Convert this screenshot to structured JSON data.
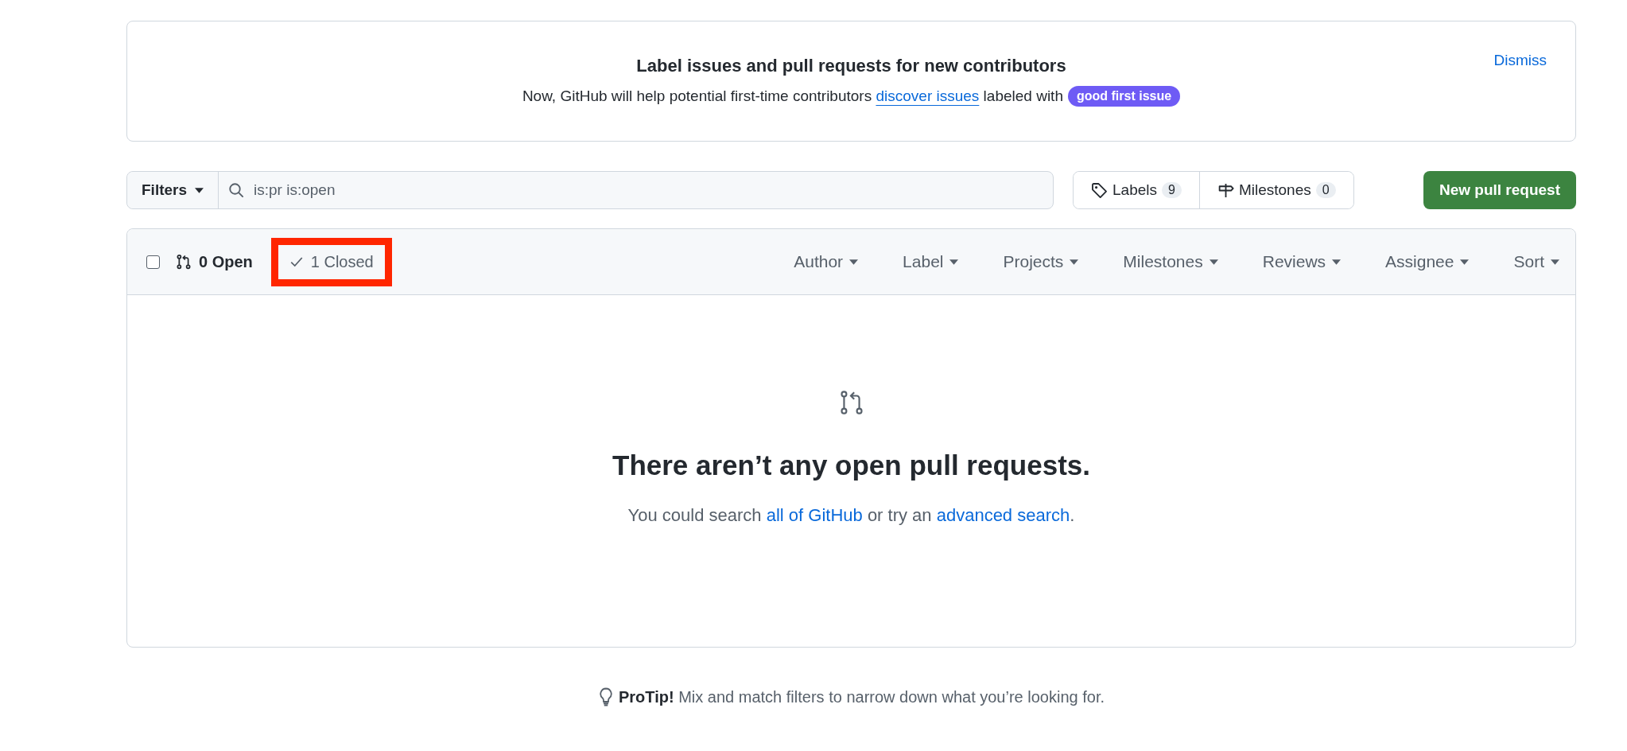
{
  "banner": {
    "title": "Label issues and pull requests for new contributors",
    "text_before": "Now, GitHub will help potential first-time contributors",
    "link": "discover issues",
    "text_after": "labeled with",
    "badge": "good first issue",
    "dismiss": "Dismiss"
  },
  "toolbar": {
    "filters_button": "Filters",
    "search_value": "is:pr is:open",
    "labels": {
      "label": "Labels",
      "count": "9"
    },
    "milestones": {
      "label": "Milestones",
      "count": "0"
    },
    "new_button": "New pull request"
  },
  "list_header": {
    "checkbox_checked": false,
    "states": [
      {
        "kind": "open",
        "label": "0 Open",
        "selected": true,
        "highlighted": false
      },
      {
        "kind": "closed",
        "label": "1 Closed",
        "selected": false,
        "highlighted": true
      }
    ],
    "filters": [
      "Author",
      "Label",
      "Projects",
      "Milestones",
      "Reviews",
      "Assignee",
      "Sort"
    ]
  },
  "empty_state": {
    "title": "There aren’t any open pull requests.",
    "text_before": "You could search",
    "link_1": "all of GitHub",
    "text_middle": "or try an",
    "link_2": "advanced search",
    "text_end": "."
  },
  "protip": "**ProTip!** Mix and match filters to narrow down what you’re looking for."
}
